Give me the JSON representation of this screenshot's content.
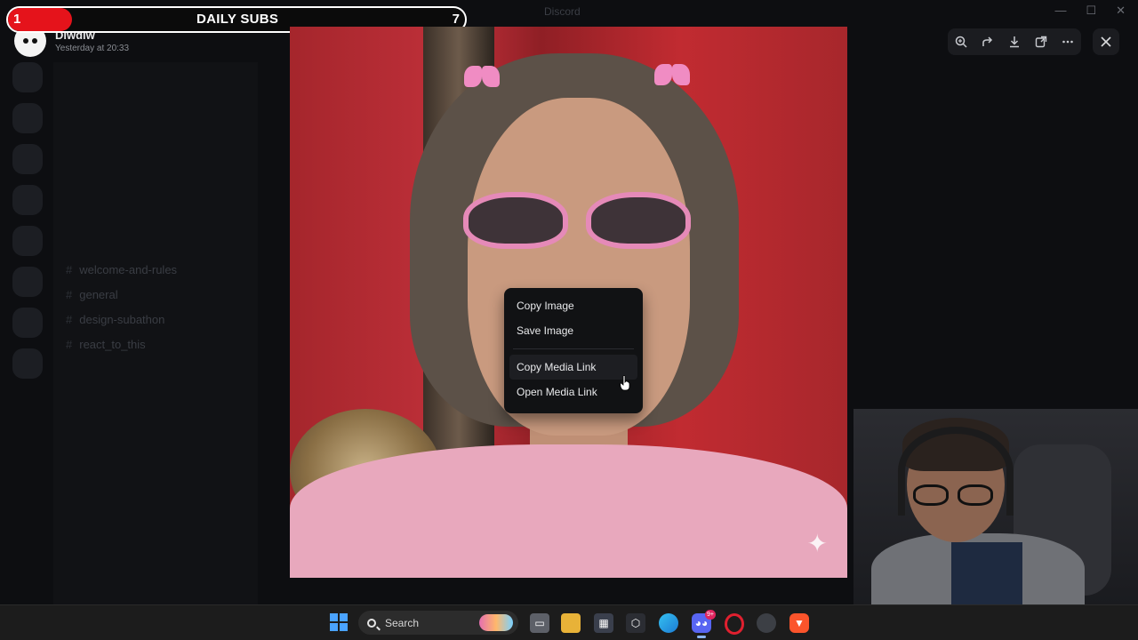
{
  "window": {
    "title": "Discord",
    "controls": [
      "minimize",
      "maximize",
      "close"
    ]
  },
  "stream_overlay": {
    "subs_label": "DAILY SUBS",
    "subs_current": "1",
    "subs_goal": "7",
    "progress_fraction": 0.14,
    "bar_color": "#e5131b"
  },
  "viewer": {
    "author_name": "Diwdiw",
    "timestamp": "Yesterday at 20:33",
    "toolbar_icons": [
      "zoom-in-icon",
      "forward-icon",
      "download-icon",
      "open-external-icon",
      "more-icon"
    ],
    "close_icon": "close-icon"
  },
  "context_menu": {
    "items": [
      {
        "label": "Copy Image"
      },
      {
        "label": "Save Image"
      },
      {
        "label": "Copy Media Link"
      },
      {
        "label": "Open Media Link"
      }
    ],
    "hovered_index": 2
  },
  "background_sidebar": {
    "channels": [
      "welcome-and-rules",
      "general",
      "design-subathon",
      "react_to_this"
    ]
  },
  "taskbar": {
    "search_placeholder": "Search",
    "apps": [
      "file-explorer-icon",
      "folder-icon",
      "store-icon",
      "app-icon",
      "edge-icon",
      "discord-icon",
      "opera-icon",
      "obs-icon",
      "brave-icon"
    ],
    "discord_badge": "9+"
  }
}
